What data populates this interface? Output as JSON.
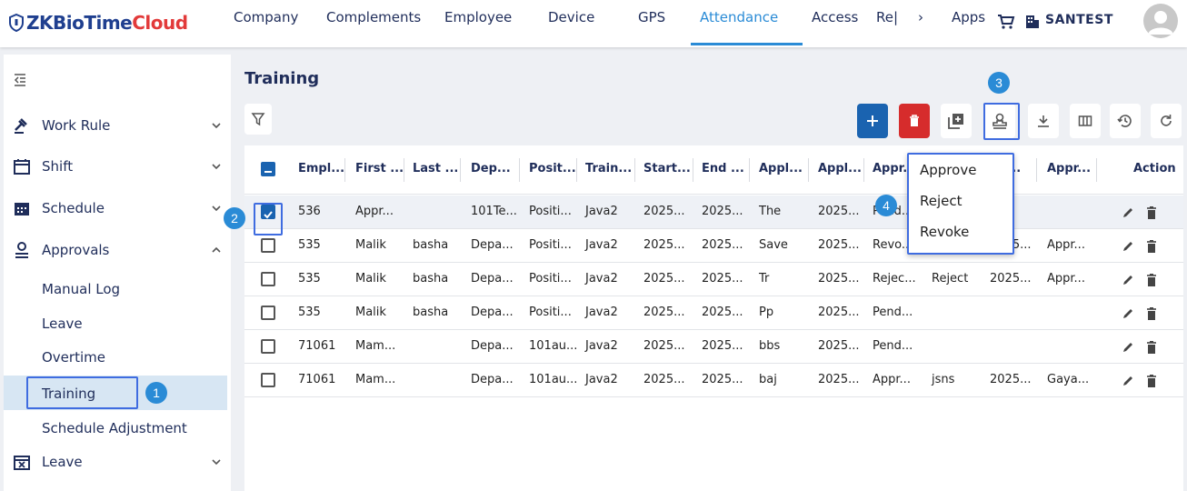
{
  "app": {
    "logo_part1": "ZKBioTime",
    "logo_part2": "Cloud"
  },
  "nav": {
    "items": [
      "Company",
      "Complements",
      "Employee",
      "Device",
      "GPS",
      "Attendance",
      "Access",
      "Re|",
      "›",
      "Apps"
    ],
    "active": "Attendance",
    "company": "SANTEST"
  },
  "sidebar": {
    "groups": [
      {
        "label": "Work Rule",
        "icon": "gavel-icon"
      },
      {
        "label": "Shift",
        "icon": "calendar-blank-icon"
      },
      {
        "label": "Schedule",
        "icon": "calendar-grid-icon"
      },
      {
        "label": "Approvals",
        "icon": "user-stamp-icon"
      }
    ],
    "approvals_items": [
      "Manual Log",
      "Leave",
      "Overtime",
      "Training",
      "Schedule Adjustment"
    ],
    "leave": {
      "label": "Leave",
      "icon": "calendar-x-icon"
    },
    "active_item": "Training"
  },
  "page": {
    "title": "Training"
  },
  "annotations": {
    "b1": "1",
    "b2": "2",
    "b3": "3",
    "b4": "4"
  },
  "table": {
    "headers": [
      "Empl...",
      "First ...",
      "Last ...",
      "Dep...",
      "Posit...",
      "Train...",
      "Start...",
      "End ...",
      "Appl...",
      "Appl...",
      "Appr...",
      "",
      "...r...",
      "Appr...",
      "Action"
    ],
    "rows": [
      {
        "selected": true,
        "cells": [
          "536",
          "Appr...",
          "",
          "101Te...",
          "Positi...",
          "Java2",
          "2025...",
          "2025...",
          "The",
          "2025...",
          "Pend...",
          "",
          "",
          ""
        ]
      },
      {
        "selected": false,
        "cells": [
          "535",
          "Malik",
          "basha",
          "Depa...",
          "Positi...",
          "Java2",
          "2025...",
          "2025...",
          "Save",
          "2025...",
          "Revo...",
          "Revo...",
          "2025...",
          "Appr..."
        ]
      },
      {
        "selected": false,
        "cells": [
          "535",
          "Malik",
          "basha",
          "Depa...",
          "Positi...",
          "Java2",
          "2025...",
          "2025...",
          "Tr",
          "2025...",
          "Rejec...",
          "Reject",
          "2025...",
          "Appr..."
        ]
      },
      {
        "selected": false,
        "cells": [
          "535",
          "Malik",
          "basha",
          "Depa...",
          "Positi...",
          "Java2",
          "2025...",
          "2025...",
          "Pp",
          "2025...",
          "Pend...",
          "",
          "",
          ""
        ]
      },
      {
        "selected": false,
        "cells": [
          "71061",
          "Mam...",
          "",
          "Depa...",
          "101au...",
          "Java2",
          "2025...",
          "2025...",
          "bbs",
          "2025...",
          "Pend...",
          "",
          "",
          ""
        ]
      },
      {
        "selected": false,
        "cells": [
          "71061",
          "Mam...",
          "",
          "Depa...",
          "101au...",
          "Java2",
          "2025...",
          "2025...",
          "baj",
          "2025...",
          "Appr...",
          "jsns",
          "2025...",
          "Gaya..."
        ]
      }
    ]
  },
  "popup_menu": {
    "items": [
      "Approve",
      "Reject",
      "Revoke"
    ]
  },
  "colors": {
    "accent": "#2a8bd6",
    "primary": "#1a63b0",
    "danger": "#d62c2c",
    "highlight": "#3f6ce0",
    "nav_text": "#1f2d5a"
  }
}
